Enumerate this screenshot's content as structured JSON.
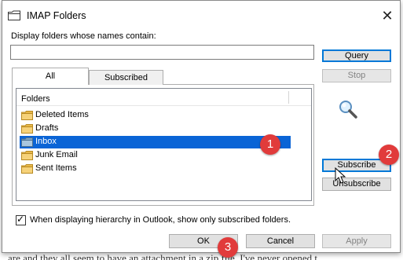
{
  "background": {
    "text": "are and they all seem to have an attachment in a zip file. I've never opened t"
  },
  "window": {
    "title": "IMAP Folders",
    "close_glyph": "✕"
  },
  "filter": {
    "label": "Display folders whose names contain:",
    "value": "",
    "placeholder": ""
  },
  "tabs": [
    {
      "label": "All"
    },
    {
      "label": "Subscribed"
    }
  ],
  "folder_list": {
    "header": "Folders",
    "items": [
      {
        "label": "Deleted Items",
        "selected": false
      },
      {
        "label": "Drafts",
        "selected": false
      },
      {
        "label": "Inbox",
        "selected": true
      },
      {
        "label": "Junk Email",
        "selected": false
      },
      {
        "label": "Sent Items",
        "selected": false
      }
    ]
  },
  "buttons": {
    "query": "Query",
    "stop": "Stop",
    "subscribe": "Subscribe",
    "unsubscribe": "Unsubscribe",
    "ok": "OK",
    "cancel": "Cancel",
    "apply": "Apply"
  },
  "option": {
    "checked": true,
    "label": "When displaying hierarchy in Outlook, show only subscribed folders."
  },
  "annotations": [
    {
      "number": "1"
    },
    {
      "number": "2"
    },
    {
      "number": "3"
    }
  ],
  "colors": {
    "selection": "#0a64d6",
    "badge": "#e13b3b",
    "default_button_border": "#0078d7",
    "folder": "#e8b84a"
  }
}
